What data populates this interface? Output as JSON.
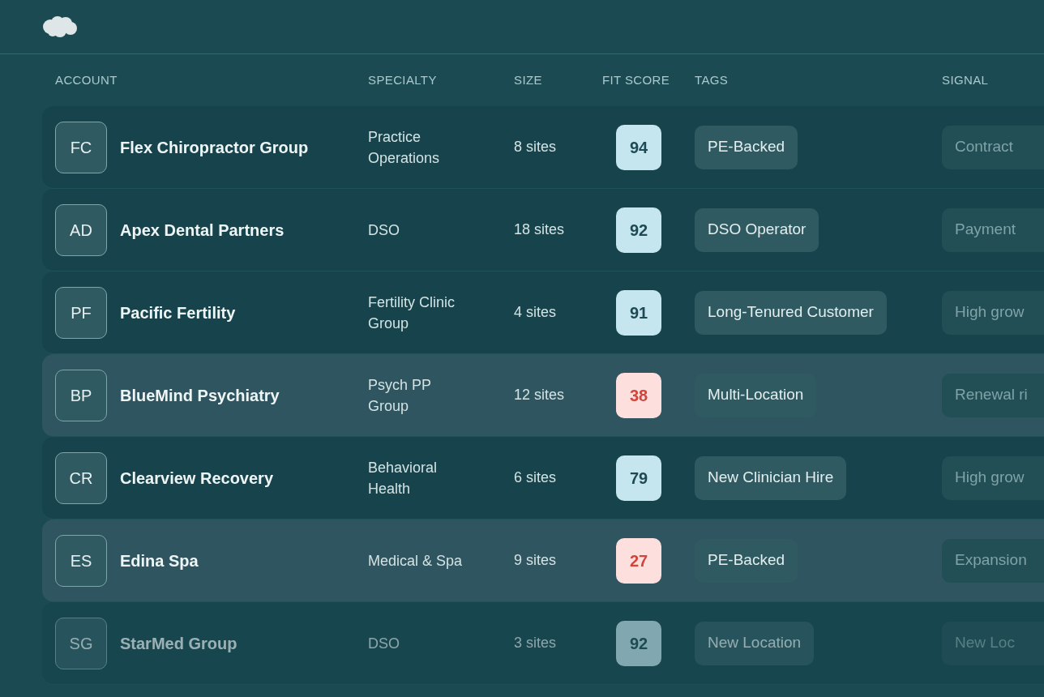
{
  "columns": [
    "ACCOUNT",
    "SPECIALTY",
    "SIZE",
    "FIT SCORE",
    "TAGS",
    "SIGNAL"
  ],
  "rows": [
    {
      "initials": "FC",
      "name": "Flex Chiropractor Group",
      "specialty": "Practice Operations",
      "size": "8 sites",
      "score": "94",
      "kind": "good",
      "tag": "PE-Backed",
      "signal": "Contract",
      "highlighted": false,
      "faded": false
    },
    {
      "initials": "AD",
      "name": "Apex Dental Partners",
      "specialty": "DSO",
      "size": "18 sites",
      "score": "92",
      "kind": "good",
      "tag": "DSO Operator",
      "signal": "Payment",
      "highlighted": false,
      "faded": false
    },
    {
      "initials": "PF",
      "name": "Pacific Fertility",
      "specialty": "Fertility Clinic Group",
      "size": "4 sites",
      "score": "91",
      "kind": "good",
      "tag": "Long-Tenured Customer",
      "signal": "High grow",
      "highlighted": false,
      "faded": false
    },
    {
      "initials": "BP",
      "name": "BlueMind Psychiatry",
      "specialty": "Psych PP Group",
      "size": "12 sites",
      "score": "38",
      "kind": "low",
      "tag": "Multi-Location",
      "signal": "Renewal ri",
      "highlighted": true,
      "faded": false
    },
    {
      "initials": "CR",
      "name": "Clearview Recovery",
      "specialty": "Behavioral Health",
      "size": "6 sites",
      "score": "79",
      "kind": "good",
      "tag": "New Clinician Hire",
      "signal": "High grow",
      "highlighted": false,
      "faded": false
    },
    {
      "initials": "ES",
      "name": "Edina Spa",
      "specialty": "Medical & Spa",
      "size": "9 sites",
      "score": "27",
      "kind": "low",
      "tag": "PE-Backed",
      "signal": "Expansion",
      "highlighted": true,
      "faded": false
    },
    {
      "initials": "SG",
      "name": "StarMed Group",
      "specialty": "DSO",
      "size": "3 sites",
      "score": "92",
      "kind": "good",
      "tag": "New Location",
      "signal": "New Loc",
      "highlighted": false,
      "faded": true
    }
  ]
}
